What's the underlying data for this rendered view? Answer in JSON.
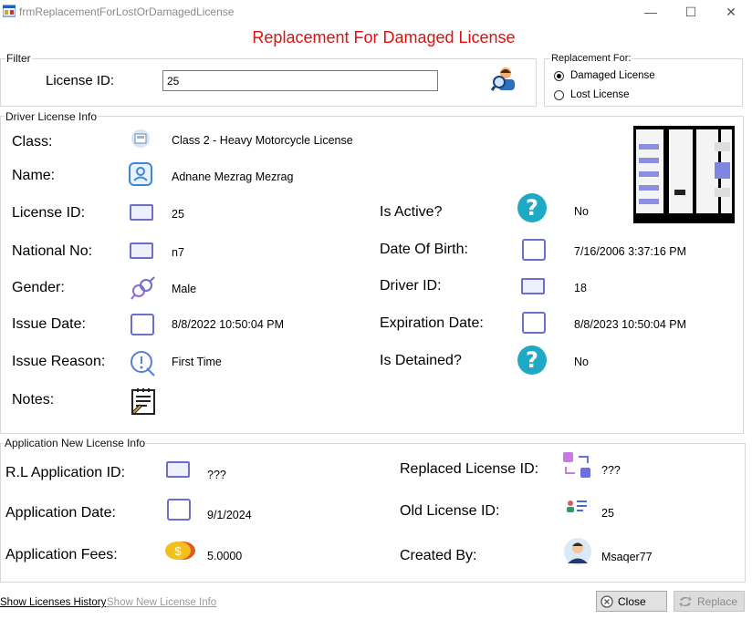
{
  "window": {
    "title": "frmReplacementForLostOrDamagedLicense",
    "minimize_glyph": "—",
    "maximize_glyph": "☐",
    "close_glyph": "✕"
  },
  "heading": "Replacement For Damaged License",
  "filter": {
    "group_label": "Filter",
    "license_id_label": "License ID:",
    "license_id_value": "25"
  },
  "replacement_for": {
    "group_label": "Replacement For:",
    "options": [
      {
        "label": "Damaged License",
        "selected": true
      },
      {
        "label": "Lost License",
        "selected": false
      }
    ]
  },
  "driver_license_info": {
    "group_label": "Driver License Info",
    "class_label": "Class:",
    "class_value": "Class 2 - Heavy Motorcycle License",
    "name_label": "Name:",
    "name_value": "Adnane Mezrag  Mezrag",
    "license_id_label": "License ID:",
    "license_id_value": "25",
    "national_no_label": "National No:",
    "national_no_value": "n7",
    "gender_label": "Gender:",
    "gender_value": "Male",
    "issue_date_label": "Issue Date:",
    "issue_date_value": "8/8/2022 10:50:04 PM",
    "issue_reason_label": "Issue Reason:",
    "issue_reason_value": "First Time",
    "notes_label": "Notes:",
    "is_active_label": "Is Active?",
    "is_active_value": "No",
    "date_of_birth_label": "Date Of Birth:",
    "date_of_birth_value": "7/16/2006 3:37:16 PM",
    "driver_id_label": "Driver ID:",
    "driver_id_value": "18",
    "expiration_date_label": "Expiration Date:",
    "expiration_date_value": "8/8/2023 10:50:04 PM",
    "is_detained_label": "Is Detained?",
    "is_detained_value": "No",
    "question_glyph": "?"
  },
  "application_info": {
    "group_label": "Application New License Info",
    "rl_application_id_label": "R.L Application ID:",
    "rl_application_id_value": "???",
    "application_date_label": "Application Date:",
    "application_date_value": "9/1/2024",
    "application_fees_label": "Application Fees:",
    "application_fees_value": "5.0000",
    "replaced_license_id_label": "Replaced License ID:",
    "replaced_license_id_value": "???",
    "old_license_id_label": "Old License ID:",
    "old_license_id_value": "25",
    "created_by_label": "Created By:",
    "created_by_value": "Msaqer77",
    "coin_glyph": "$"
  },
  "footer": {
    "show_licenses_history": "Show Licenses History",
    "show_new_license_info": "Show New License Info",
    "close_button": "Close",
    "replace_button": "Replace"
  }
}
